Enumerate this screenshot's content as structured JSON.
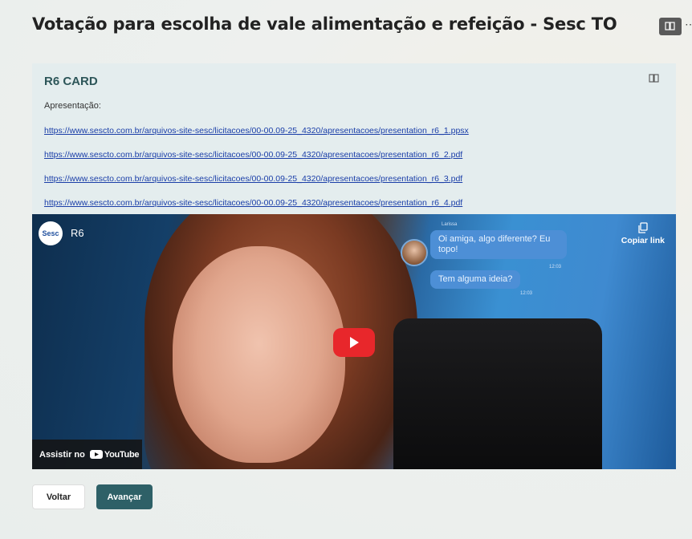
{
  "form": {
    "title": "Votação para escolha de vale alimentação e refeição - Sesc TO"
  },
  "card": {
    "title": "R6 CARD",
    "section_label": "Apresentação:",
    "links": [
      "https://www.sescto.com.br/arquivos-site-sesc/licitacoes/00-00.09-25_4320/apresentacoes/presentation_r6_1.ppsx",
      "https://www.sescto.com.br/arquivos-site-sesc/licitacoes/00-00.09-25_4320/apresentacoes/presentation_r6_2.pdf",
      "https://www.sescto.com.br/arquivos-site-sesc/licitacoes/00-00.09-25_4320/apresentacoes/presentation_r6_3.pdf",
      "https://www.sescto.com.br/arquivos-site-sesc/licitacoes/00-00.09-25_4320/apresentacoes/presentation_r6_4.pdf"
    ]
  },
  "video": {
    "channel_logo": "Sesc",
    "title": "R6",
    "copy_link": "Copiar link",
    "chat_sender": "Larissa",
    "chat": [
      {
        "text": "Oi amiga, algo diferente? Eu topo!",
        "time": "12:03"
      },
      {
        "text": "Tem alguma ideia?",
        "time": "12:03"
      }
    ],
    "watch_on": "Assistir no",
    "youtube": "YouTube"
  },
  "nav": {
    "back": "Voltar",
    "next": "Avançar"
  },
  "colors": {
    "accent": "#2e6067",
    "card_bg": "#e4edee",
    "link": "#1a3ea8",
    "youtube_red": "#e8272b"
  }
}
